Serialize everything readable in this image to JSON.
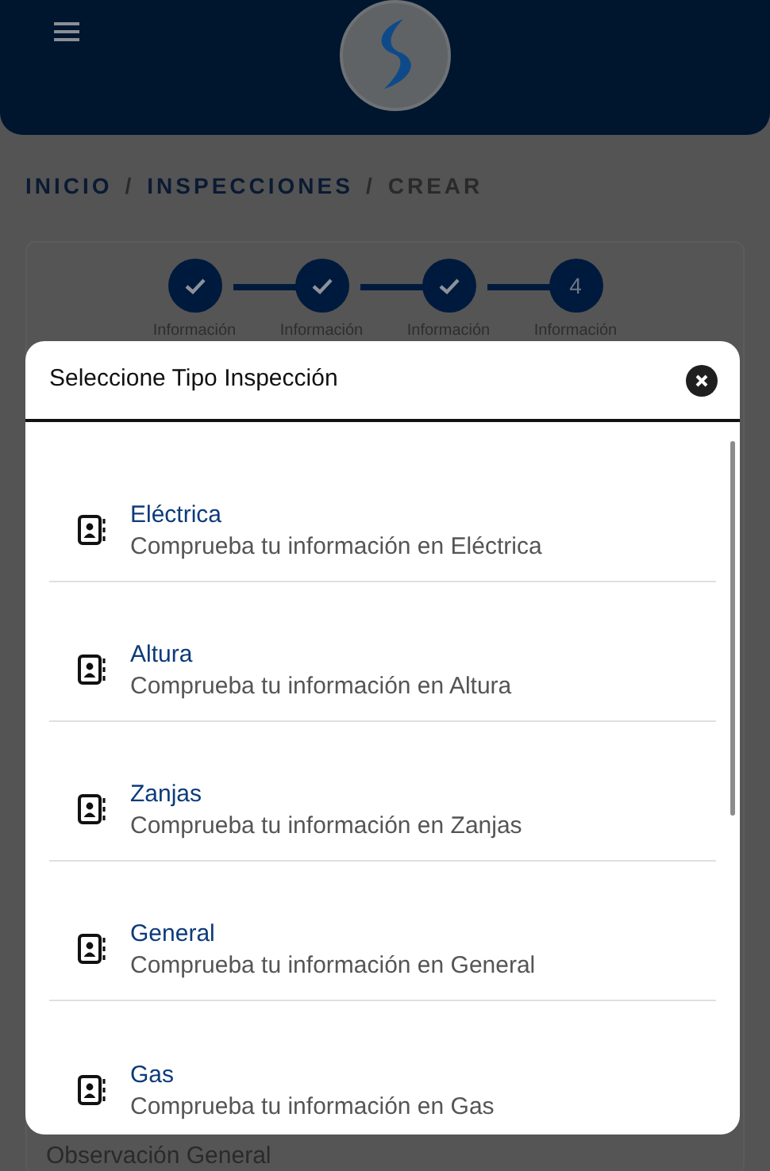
{
  "breadcrumb": [
    {
      "label": "INICIO",
      "selected": false
    },
    {
      "label": "INSPECCIONES",
      "selected": false
    },
    {
      "label": "CREAR",
      "selected": true
    }
  ],
  "separator": "/",
  "steps": [
    {
      "label": "Información",
      "completed": true
    },
    {
      "label": "Información",
      "completed": true
    },
    {
      "label": "Información",
      "completed": true
    },
    {
      "label": "Información",
      "completed": false,
      "number": "4"
    }
  ],
  "modal": {
    "title": "Seleccione Tipo Inspección",
    "items": [
      {
        "title": "Eléctrica",
        "description": "Comprueba tu información en Eléctrica"
      },
      {
        "title": "Altura",
        "description": "Comprueba tu información en Altura"
      },
      {
        "title": "Zanjas",
        "description": "Comprueba tu información en Zanjas"
      },
      {
        "title": "General",
        "description": "Comprueba tu información en General"
      },
      {
        "title": "Gas",
        "description": "Comprueba tu información en Gas"
      }
    ]
  },
  "background_field_label": "Observación General"
}
